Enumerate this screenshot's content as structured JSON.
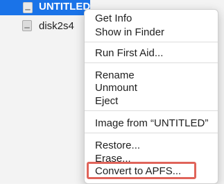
{
  "sidebar": {
    "items": [
      {
        "label": "UNTITLED",
        "selected": true,
        "icon": "disk-icon"
      },
      {
        "label": "disk2s4",
        "selected": false,
        "icon": "disk-icon"
      }
    ],
    "selection_color": "#1a73e8"
  },
  "context_menu": {
    "groups": [
      [
        "Get Info",
        "Show in Finder"
      ],
      [
        "Run First Aid..."
      ],
      [
        "Rename",
        "Unmount",
        "Eject"
      ],
      [
        "Image from “UNTITLED”"
      ],
      [
        "Restore...",
        "Erase...",
        "Convert to APFS..."
      ]
    ],
    "highlighted_item": "Convert to APFS...",
    "highlight_color": "#e0645a"
  }
}
